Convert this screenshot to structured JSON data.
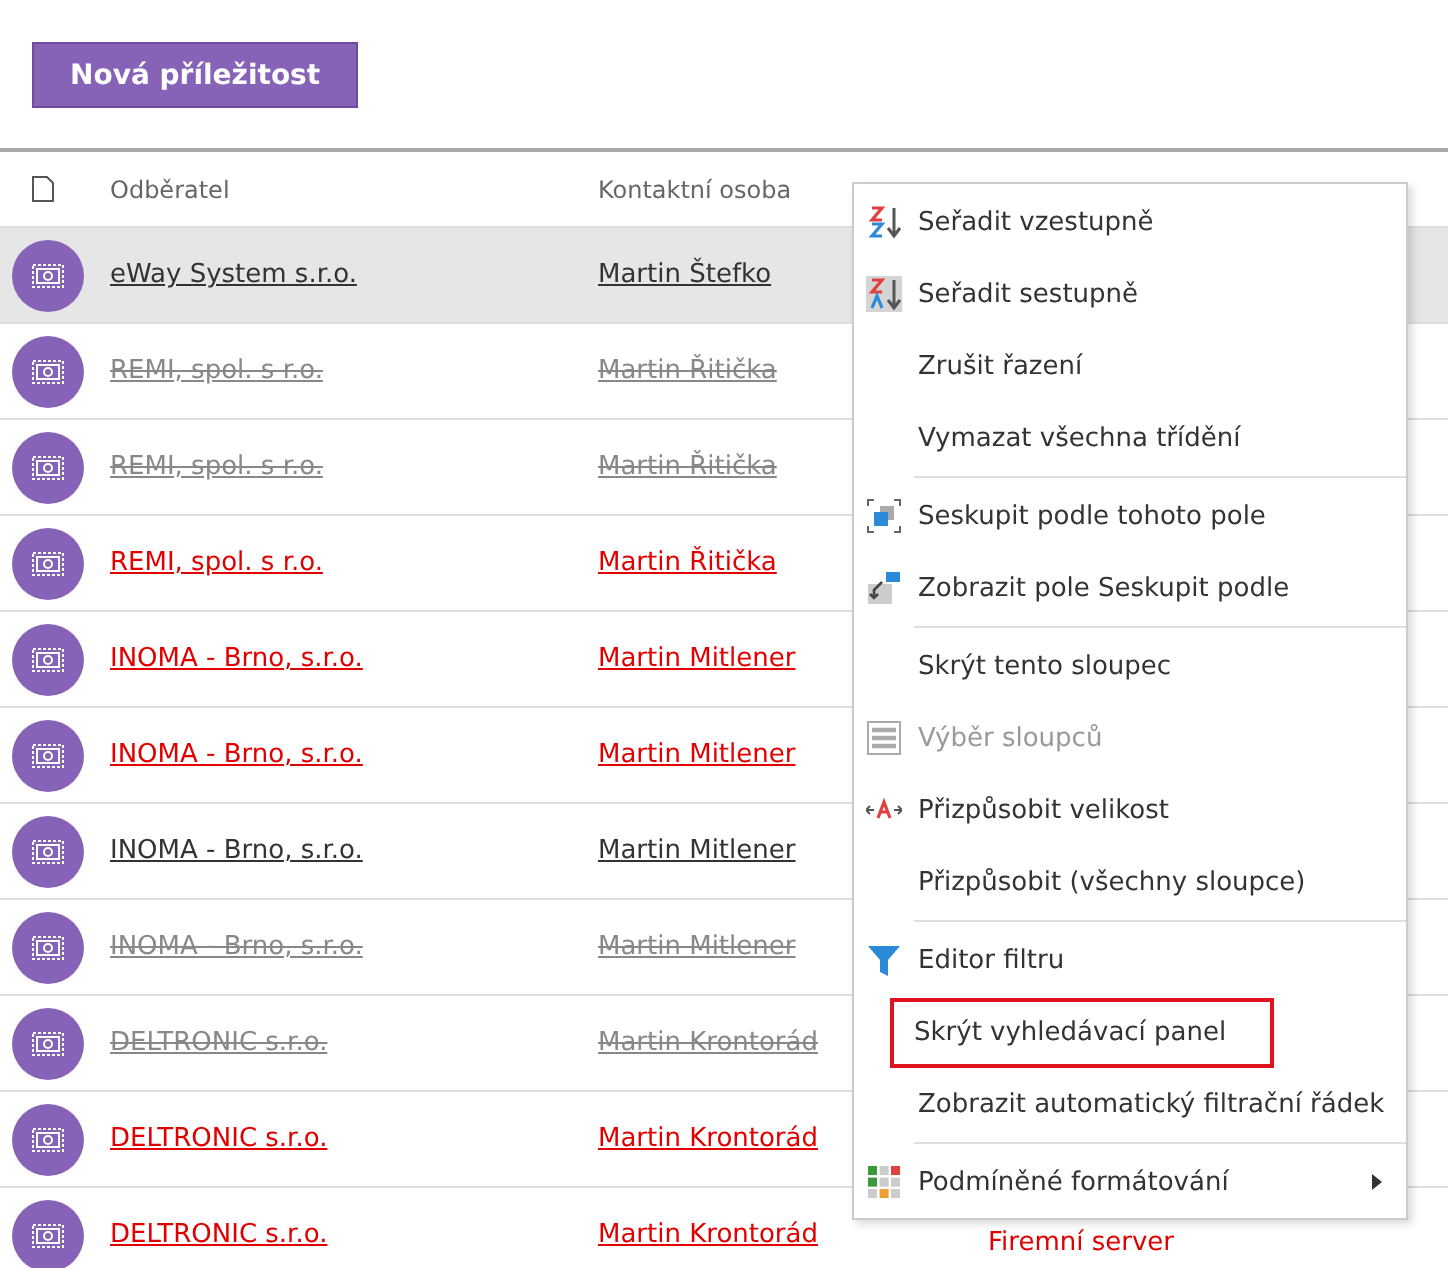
{
  "toolbar": {
    "new_button": "Nová příležitost"
  },
  "table": {
    "columns": [
      {
        "label": "Odběratel"
      },
      {
        "label": "Kontaktní osoba"
      }
    ],
    "rows": [
      {
        "customer": "eWay System s.r.o.",
        "contact": "Martin Štefko",
        "kind": "normal",
        "selected": true
      },
      {
        "customer": "REMI, spol. s r.o.",
        "contact": "Martin Řitička",
        "kind": "struck",
        "selected": false
      },
      {
        "customer": "REMI, spol. s r.o.",
        "contact": "Martin Řitička",
        "kind": "struck",
        "selected": false
      },
      {
        "customer": "REMI, spol. s r.o.",
        "contact": "Martin Řitička",
        "kind": "alert",
        "selected": false
      },
      {
        "customer": "INOMA - Brno, s.r.o.",
        "contact": "Martin Mitlener",
        "kind": "alert",
        "selected": false
      },
      {
        "customer": "INOMA - Brno, s.r.o.",
        "contact": "Martin Mitlener",
        "kind": "alert",
        "selected": false
      },
      {
        "customer": "INOMA - Brno, s.r.o.",
        "contact": "Martin Mitlener",
        "kind": "normal",
        "selected": false
      },
      {
        "customer": "INOMA - Brno, s.r.o.",
        "contact": "Martin Mitlener",
        "kind": "struck",
        "selected": false
      },
      {
        "customer": "DELTRONIC s.r.o.",
        "contact": "Martin Krontorád",
        "kind": "struck",
        "selected": false
      },
      {
        "customer": "DELTRONIC s.r.o.",
        "contact": "Martin Krontorád",
        "kind": "alert",
        "selected": false
      },
      {
        "customer": "DELTRONIC s.r.o.",
        "contact": "Martin Krontorád",
        "kind": "alert",
        "selected": false,
        "title": "Firemní server"
      }
    ]
  },
  "context_menu": {
    "groups": [
      [
        {
          "label": "Seřadit vzestupně",
          "kind": "sort-ascending",
          "disabled": false,
          "highlighted": false
        },
        {
          "label": "Seřadit sestupně",
          "kind": "sort-descending",
          "disabled": false,
          "highlighted": false
        },
        {
          "label": "Zrušit řazení",
          "kind": "plain",
          "disabled": false,
          "highlighted": false
        },
        {
          "label": "Vymazat všechna třídění",
          "kind": "plain",
          "disabled": false,
          "highlighted": false
        }
      ],
      [
        {
          "label": "Seskupit podle tohoto pole",
          "kind": "group",
          "disabled": false,
          "highlighted": false
        },
        {
          "label": "Zobrazit pole Seskupit podle",
          "kind": "group-panel",
          "disabled": false,
          "highlighted": false
        }
      ],
      [
        {
          "label": "Skrýt tento sloupec",
          "kind": "plain",
          "disabled": false,
          "highlighted": false
        },
        {
          "label": "Výběr sloupců",
          "kind": "columns",
          "disabled": true,
          "highlighted": false
        },
        {
          "label": "Přizpůsobit velikost",
          "kind": "fit",
          "disabled": false,
          "highlighted": false
        },
        {
          "label": "Přizpůsobit (všechny sloupce)",
          "kind": "plain",
          "disabled": false,
          "highlighted": false
        }
      ],
      [
        {
          "label": "Editor filtru",
          "kind": "filter",
          "disabled": false,
          "highlighted": false
        },
        {
          "label": "Skrýt vyhledávací panel",
          "kind": "plain",
          "disabled": false,
          "highlighted": true
        },
        {
          "label": "Zobrazit automatický filtrační řádek",
          "kind": "plain",
          "disabled": false,
          "highlighted": false
        }
      ],
      [
        {
          "label": "Podmíněné formátování",
          "kind": "format",
          "disabled": false,
          "highlighted": false,
          "submenu": true
        }
      ]
    ]
  }
}
